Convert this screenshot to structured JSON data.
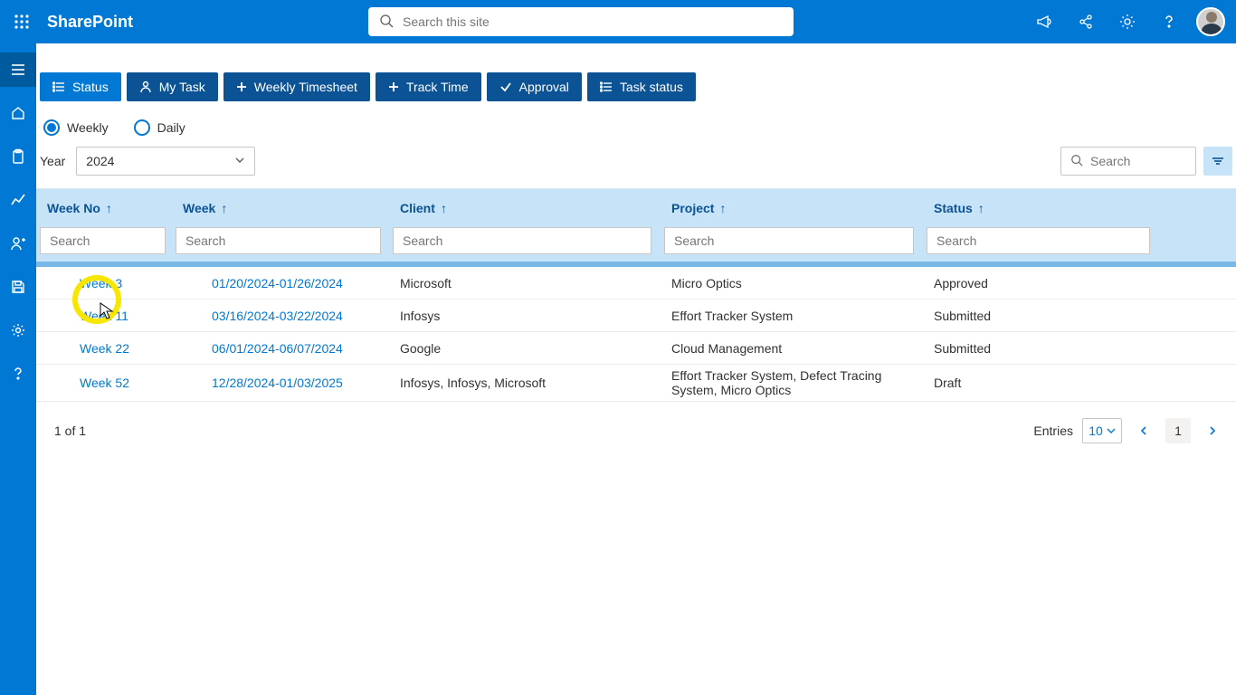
{
  "suite": {
    "brand": "SharePoint",
    "search_placeholder": "Search this site"
  },
  "leftnav": {
    "items": [
      "menu",
      "home",
      "clipboard",
      "chart",
      "user-plus",
      "save",
      "gear",
      "help"
    ]
  },
  "tabs": [
    {
      "icon": "list",
      "label": "Status",
      "active": true
    },
    {
      "icon": "person",
      "label": "My Task",
      "active": false
    },
    {
      "icon": "plus",
      "label": "Weekly Timesheet",
      "active": false
    },
    {
      "icon": "plus",
      "label": "Track Time",
      "active": false
    },
    {
      "icon": "check",
      "label": "Approval",
      "active": false
    },
    {
      "icon": "list",
      "label": "Task status",
      "active": false
    }
  ],
  "periodFilter": {
    "options": [
      {
        "label": "Weekly",
        "checked": true
      },
      {
        "label": "Daily",
        "checked": false
      }
    ]
  },
  "year": {
    "label": "Year",
    "value": "2024"
  },
  "gridSearch": {
    "placeholder": "Search"
  },
  "columns": [
    {
      "label": "Week No",
      "search_ph": "Search"
    },
    {
      "label": "Week",
      "search_ph": "Search"
    },
    {
      "label": "Client",
      "search_ph": "Search"
    },
    {
      "label": "Project",
      "search_ph": "Search"
    },
    {
      "label": "Status",
      "search_ph": "Search"
    }
  ],
  "rows": [
    {
      "weekNo": "Week 3",
      "week": "01/20/2024-01/26/2024",
      "client": "Microsoft",
      "project": "Micro Optics",
      "status": "Approved"
    },
    {
      "weekNo": "Week 11",
      "week": "03/16/2024-03/22/2024",
      "client": "Infosys",
      "project": "Effort Tracker System",
      "status": "Submitted"
    },
    {
      "weekNo": "Week 22",
      "week": "06/01/2024-06/07/2024",
      "client": "Google",
      "project": "Cloud Management",
      "status": "Submitted"
    },
    {
      "weekNo": "Week 52",
      "week": "12/28/2024-01/03/2025",
      "client": "Infosys, Infosys, Microsoft",
      "project": "Effort Tracker System, Defect Tracing System, Micro Optics",
      "status": "Draft"
    }
  ],
  "pager": {
    "pageInfo": "1 of 1",
    "entriesLabel": "Entries",
    "pageSize": "10",
    "current": "1"
  }
}
